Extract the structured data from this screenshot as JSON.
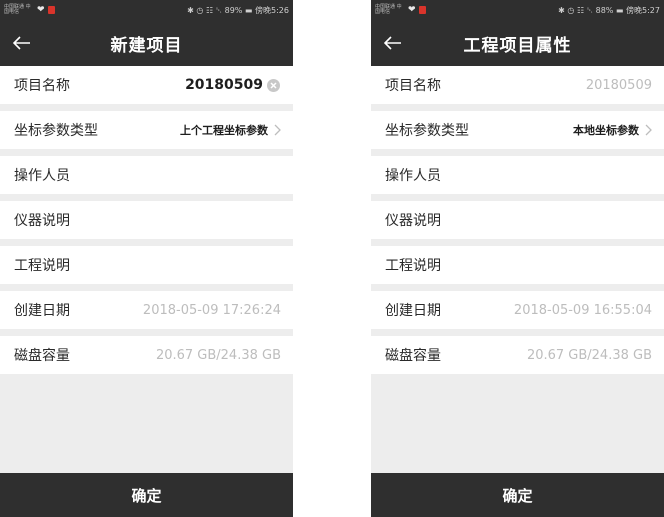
{
  "left": {
    "status": {
      "carrier": "中国联通 中国电信",
      "time_text": "✱ ◷ ☷ ␡ 89% ▬ 傍晚5:26"
    },
    "title": "新建项目",
    "fields": [
      {
        "label": "项目名称",
        "value": "20180509"
      },
      {
        "label": "坐标参数类型",
        "value": "上个工程坐标参数"
      },
      {
        "label": "操作人员",
        "value": ""
      },
      {
        "label": "仪器说明",
        "value": ""
      },
      {
        "label": "工程说明",
        "value": ""
      },
      {
        "label": "创建日期",
        "value": "2018-05-09 17:26:24"
      },
      {
        "label": "磁盘容量",
        "value": "20.67 GB/24.38 GB"
      }
    ],
    "confirm_label": "确定"
  },
  "right": {
    "status": {
      "carrier": "中国联通 中国电信",
      "time_text": "✱ ◷ ☷ ␡ 88% ▬ 傍晚5:27"
    },
    "title": "工程项目属性",
    "fields": [
      {
        "label": "项目名称",
        "value": "20180509"
      },
      {
        "label": "坐标参数类型",
        "value": "本地坐标参数"
      },
      {
        "label": "操作人员",
        "value": ""
      },
      {
        "label": "仪器说明",
        "value": ""
      },
      {
        "label": "工程说明",
        "value": ""
      },
      {
        "label": "创建日期",
        "value": "2018-05-09 16:55:04"
      },
      {
        "label": "磁盘容量",
        "value": "20.67 GB/24.38 GB"
      }
    ],
    "confirm_label": "确定"
  },
  "icons": {
    "back": "arrow-left-icon",
    "clear": "clear-circle-icon",
    "chevron": "chevron-right-icon",
    "heart": "heart-icon"
  },
  "colors": {
    "bar": "#2f2f2f",
    "background": "#ededed",
    "row": "#ffffff",
    "text": "#2a2a2a",
    "muted": "#b9b9b9"
  }
}
